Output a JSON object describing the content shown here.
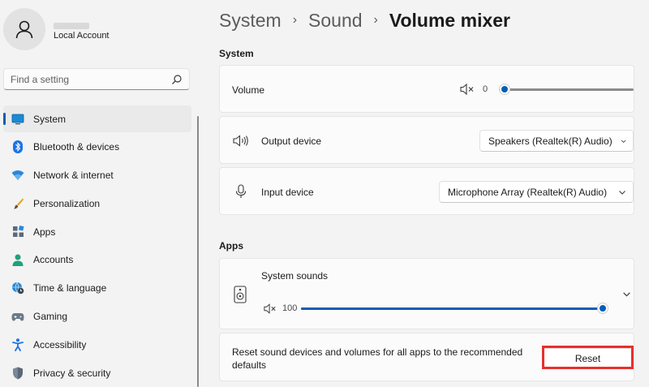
{
  "sidebar": {
    "profile": {
      "name": "",
      "account_type": "Local Account"
    },
    "search": {
      "placeholder": "Find a setting",
      "value": ""
    },
    "items": [
      {
        "label": "System",
        "icon": "monitor-icon",
        "active": true
      },
      {
        "label": "Bluetooth & devices",
        "icon": "bluetooth-icon"
      },
      {
        "label": "Network & internet",
        "icon": "wifi-icon"
      },
      {
        "label": "Personalization",
        "icon": "paintbrush-icon"
      },
      {
        "label": "Apps",
        "icon": "apps-icon"
      },
      {
        "label": "Accounts",
        "icon": "person-icon"
      },
      {
        "label": "Time & language",
        "icon": "globe-clock-icon"
      },
      {
        "label": "Gaming",
        "icon": "gamepad-icon"
      },
      {
        "label": "Accessibility",
        "icon": "accessibility-icon"
      },
      {
        "label": "Privacy & security",
        "icon": "shield-icon"
      }
    ]
  },
  "breadcrumb": {
    "level1": "System",
    "level2": "Sound",
    "current": "Volume mixer",
    "separator": "›"
  },
  "system_section": {
    "title": "System",
    "volume": {
      "label": "Volume",
      "value": "0",
      "level": 0
    },
    "output_device": {
      "label": "Output device",
      "selected": "Speakers (Realtek(R) Audio)"
    },
    "input_device": {
      "label": "Input device",
      "selected": "Microphone Array (Realtek(R) Audio)"
    }
  },
  "apps_section": {
    "title": "Apps",
    "system_sounds": {
      "label": "System sounds",
      "value": "100",
      "level": 100
    },
    "reset": {
      "description": "Reset sound devices and volumes for all apps to the recommended defaults",
      "button_label": "Reset"
    }
  },
  "colors": {
    "accent": "#005fb8",
    "highlight": "#e8302b",
    "background": "#f3f3f3",
    "card": "#fbfbfb"
  }
}
